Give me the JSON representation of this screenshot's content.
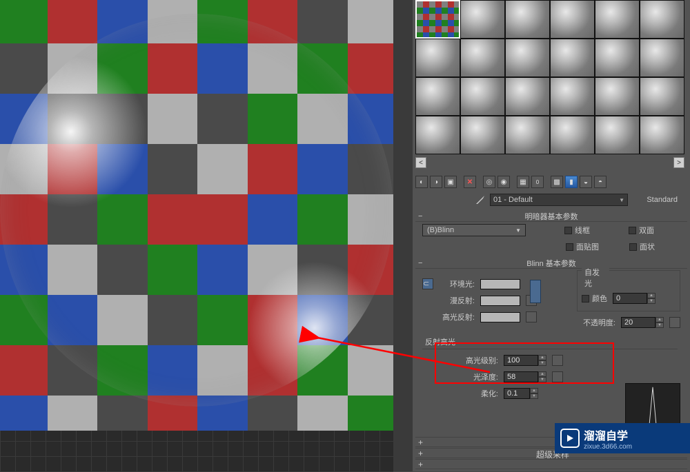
{
  "material": {
    "name": "01 - Default",
    "type_button": "Standard"
  },
  "toolbar_icons": [
    "sample",
    "assign",
    "reset",
    "delete",
    "pick",
    "put",
    "show",
    "options",
    "checker",
    "back",
    "make",
    "go"
  ],
  "rollouts": {
    "shader": {
      "title": "明暗器基本参数",
      "shader_name": "(B)Blinn",
      "wireframe": "线框",
      "two_sided": "双面",
      "face_map": "面贴图",
      "faceted": "面状"
    },
    "blinn": {
      "title": "Blinn 基本参数",
      "self_illum_group": "自发光",
      "ambient": "环境光:",
      "diffuse": "漫反射:",
      "specular": "高光反射:",
      "color_label": "颜色",
      "color_value": "0",
      "opacity_label": "不透明度:",
      "opacity_value": "20",
      "spec_group": "反射高光",
      "spec_level_label": "高光级别:",
      "spec_level_value": "100",
      "glossiness_label": "光泽度:",
      "glossiness_value": "58",
      "soften_label": "柔化:",
      "soften_value": "0.1"
    },
    "supersample": {
      "title": "超级采样"
    }
  },
  "watermark": {
    "brand": "溜溜自学",
    "url": "zixue.3d66.com"
  },
  "colors": {
    "bg": "#535353",
    "red": "#ff0000"
  }
}
